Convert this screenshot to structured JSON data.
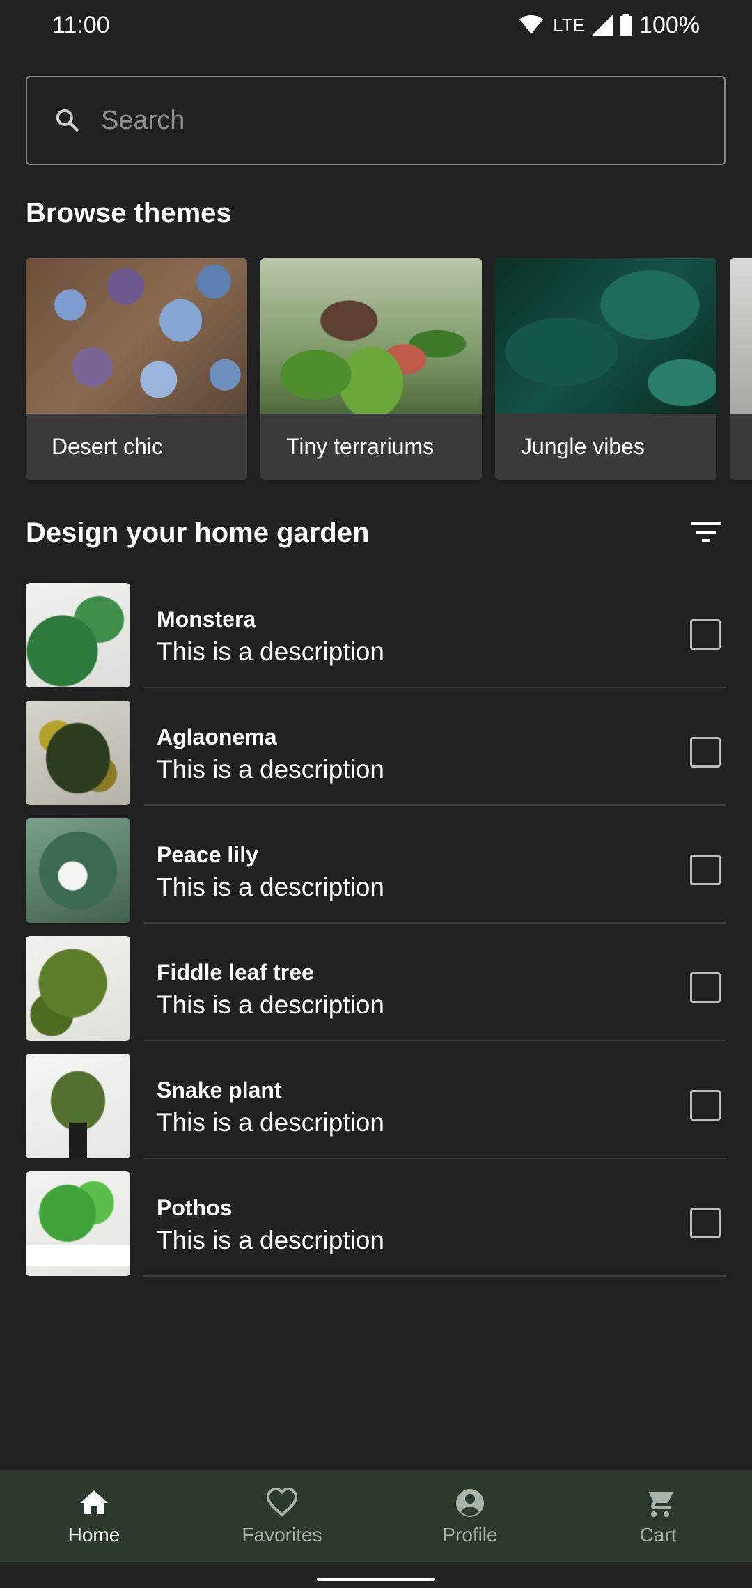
{
  "status_bar": {
    "time": "11:00",
    "network": "LTE",
    "battery": "100%"
  },
  "search": {
    "placeholder": "Search"
  },
  "themes": {
    "title": "Browse themes",
    "items": [
      {
        "label": "Desert chic"
      },
      {
        "label": "Tiny terrariums"
      },
      {
        "label": "Jungle vibes"
      }
    ]
  },
  "garden": {
    "title": "Design your home garden",
    "items": [
      {
        "name": "Monstera",
        "description": "This is a description",
        "checked": false
      },
      {
        "name": "Aglaonema",
        "description": "This is a description",
        "checked": false
      },
      {
        "name": "Peace lily",
        "description": "This is a description",
        "checked": false
      },
      {
        "name": "Fiddle leaf tree",
        "description": "This is a description",
        "checked": false
      },
      {
        "name": "Snake plant",
        "description": "This is a description",
        "checked": false
      },
      {
        "name": "Pothos",
        "description": "This is a description",
        "checked": false
      }
    ]
  },
  "bottom_nav": {
    "items": [
      {
        "label": "Home",
        "icon": "home-icon",
        "active": true
      },
      {
        "label": "Favorites",
        "icon": "heart-icon",
        "active": false
      },
      {
        "label": "Profile",
        "icon": "account-circle-icon",
        "active": false
      },
      {
        "label": "Cart",
        "icon": "cart-icon",
        "active": false
      }
    ]
  },
  "colors": {
    "background": "#212121",
    "bottom_nav": "#2c3a2d",
    "card": "#3a3a3a"
  }
}
